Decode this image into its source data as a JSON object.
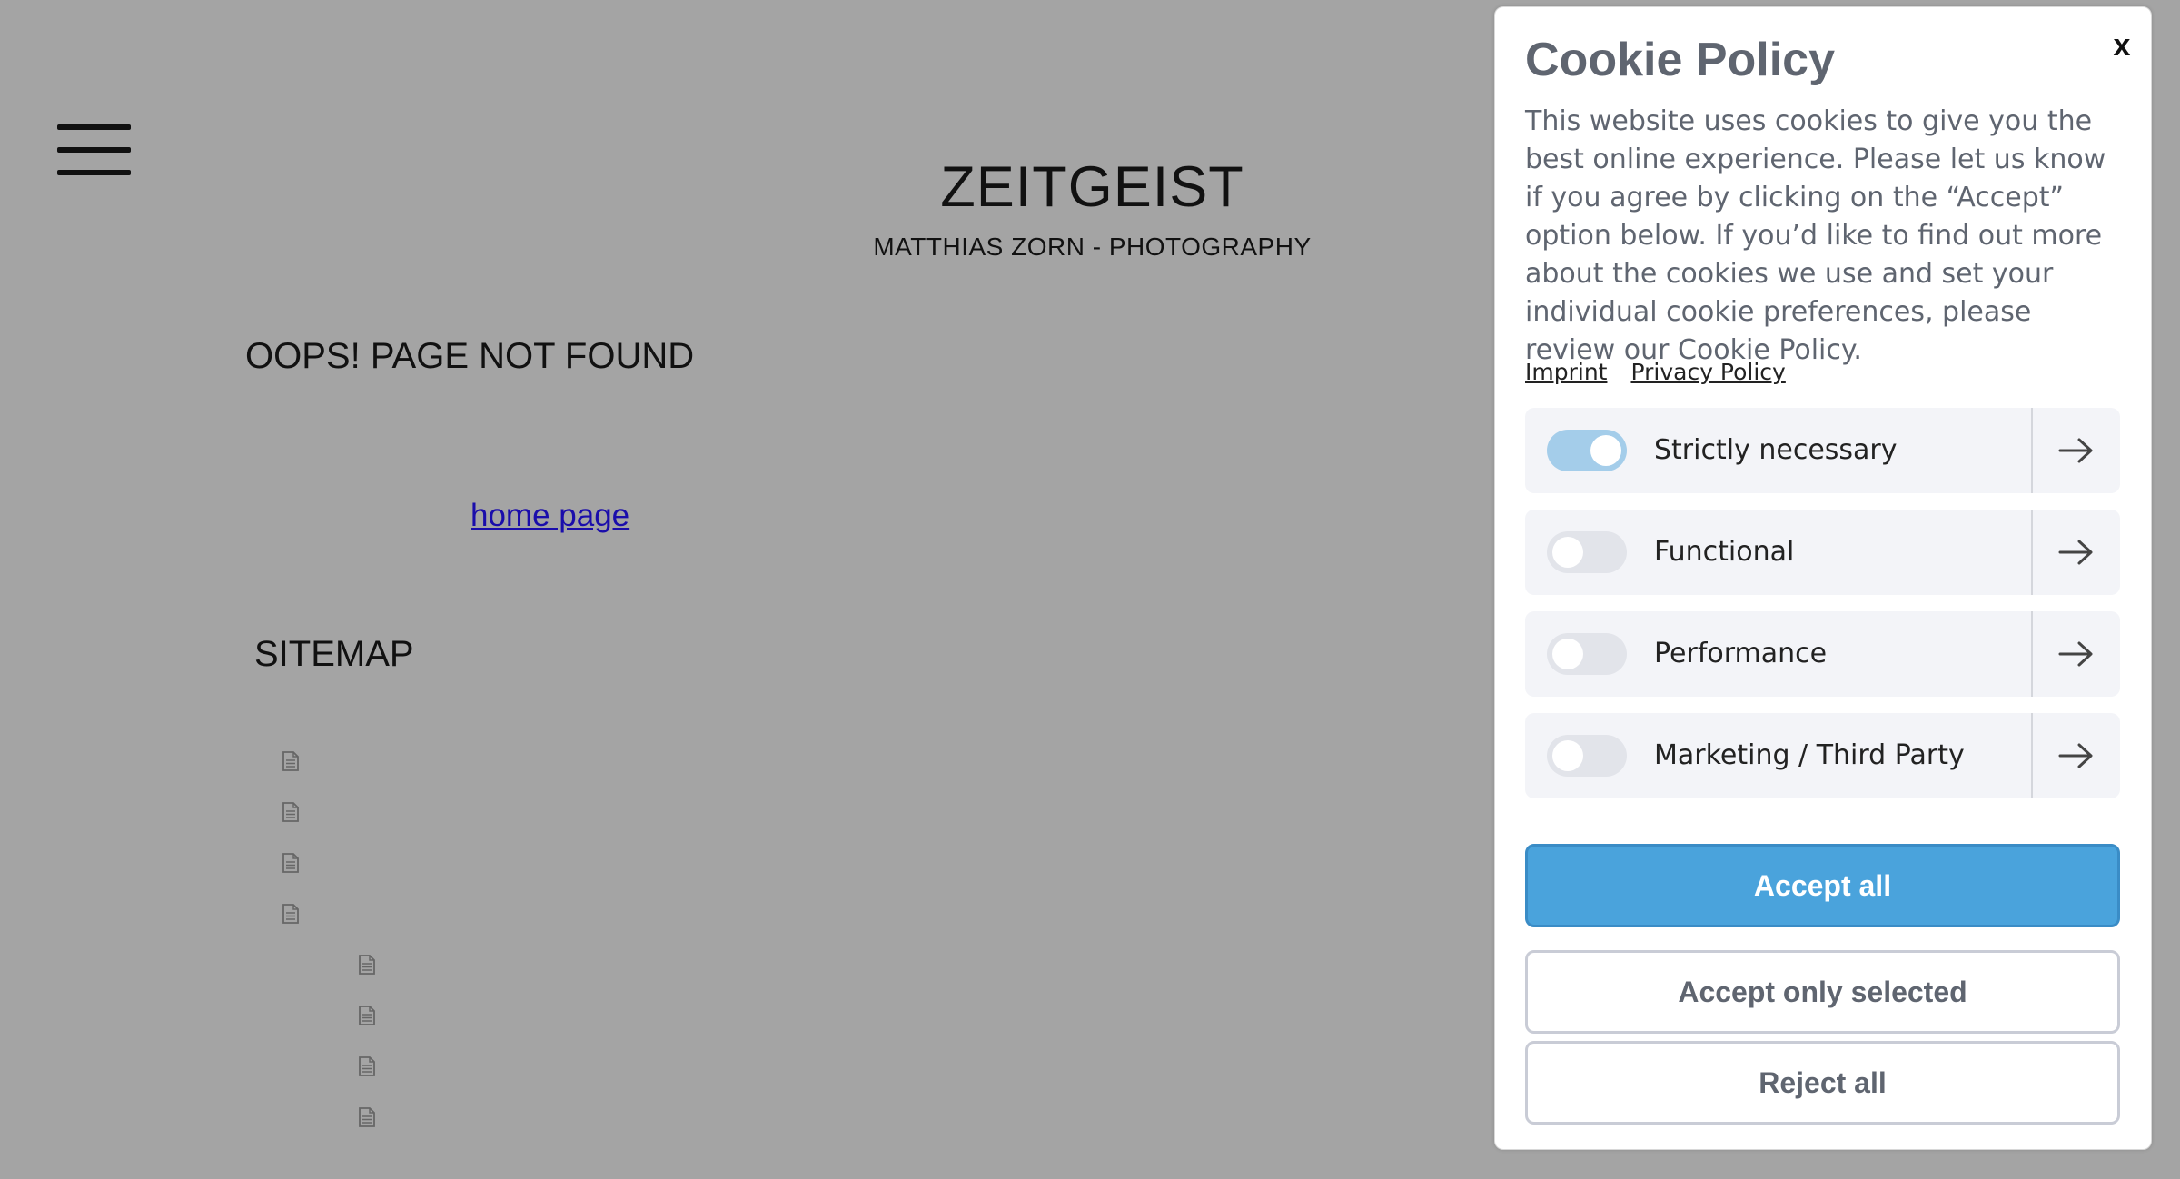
{
  "page": {
    "site_title": "ZEITGEIST",
    "site_subtitle": "MATTHIAS ZORN - PHOTOGRAPHY",
    "error_title": "OOPS! PAGE NOT FOUND",
    "home_link": "home page",
    "sitemap_title": "SITEMAP",
    "sitemap_item_icon": "document-icon",
    "menu_icon": "hamburger-menu-icon",
    "background_color": "#a4a4a4"
  },
  "cookie": {
    "title": "Cookie Policy",
    "close_label": "x",
    "description": "This website uses cookies to give you the best online experience. Please let us know if you agree by clicking on the “Accept” option below. If you’d like to find out more about the cookies we use and set your individual cookie preferences, please review our Cookie Policy.",
    "links": [
      "Imprint",
      "Privacy Policy"
    ],
    "categories": [
      {
        "label": "Strictly necessary",
        "enabled": true
      },
      {
        "label": "Functional",
        "enabled": false
      },
      {
        "label": "Performance",
        "enabled": false
      },
      {
        "label": "Marketing / Third Party",
        "enabled": false
      }
    ],
    "arrow_icon": "arrow-right-icon",
    "buttons": {
      "accept_all": "Accept all",
      "accept_selected": "Accept only selected",
      "reject_all": "Reject all"
    },
    "accent_color": "#4aa3dc",
    "toggle_on_color": "#a4cdea"
  }
}
